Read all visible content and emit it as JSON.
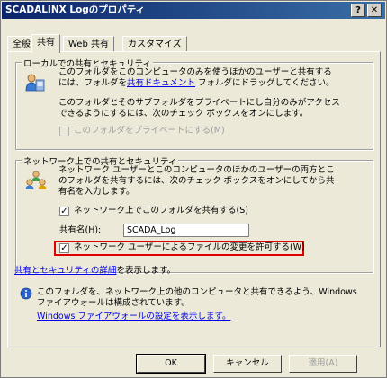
{
  "window": {
    "title": "SCADALINX Logのプロパティ",
    "help_label": "?",
    "close_label": "✕"
  },
  "tabs": [
    {
      "label": "全般"
    },
    {
      "label": "共有"
    },
    {
      "label": "Web 共有"
    },
    {
      "label": "カスタマイズ"
    }
  ],
  "local_sharing": {
    "legend": "ローカルでの共有とセキュリティ",
    "line1": "このフォルダをこのコンピュータのみを使うほかのユーザーと共有する",
    "line2_pre": "には、フォルダを",
    "line2_link": "共有ドキュメント",
    "line2_post": " フォルダにドラッグしてください。",
    "line3": "このフォルダとそのサブフォルダをプライベートにし自分のみがアクセス",
    "line4": "できるようにするには、次のチェック ボックスをオンにします。",
    "private_checkbox_label": "このフォルダをプライベートにする(M)",
    "private_checked": false
  },
  "network_sharing": {
    "legend": "ネットワーク上での共有とセキュリティ",
    "line1": "ネットワーク ユーザーとこのコンピュータのほかのユーザーの両方とこ",
    "line2": "のフォルダを共有するには、次のチェック ボックスをオンにしてから共",
    "line3": "有名を入力します。",
    "share_checkbox_label": "ネットワーク上でこのフォルダを共有する(S)",
    "share_checked": true,
    "share_name_label": "共有名(H):",
    "share_name_value": "SCADA_Log",
    "allow_change_label": "ネットワーク ユーザーによるファイルの変更を許可する(W)",
    "allow_change_checked": true,
    "details_link": "共有とセキュリティの詳細",
    "details_suffix": "を表示します。"
  },
  "firewall": {
    "line1": "このフォルダを、ネットワーク上の他のコンピュータと共有できるよう、Windows",
    "line2": "ファイアウォールは構成されています。",
    "settings_link": "Windows ファイアウォールの設定を表示します。"
  },
  "buttons": {
    "ok": "OK",
    "cancel": "キャンセル",
    "apply": "適用(A)"
  },
  "check_mark": "✓",
  "colors": {
    "title_bar": "#0a246a",
    "highlight": "#e00000",
    "link": "#0000ee"
  }
}
